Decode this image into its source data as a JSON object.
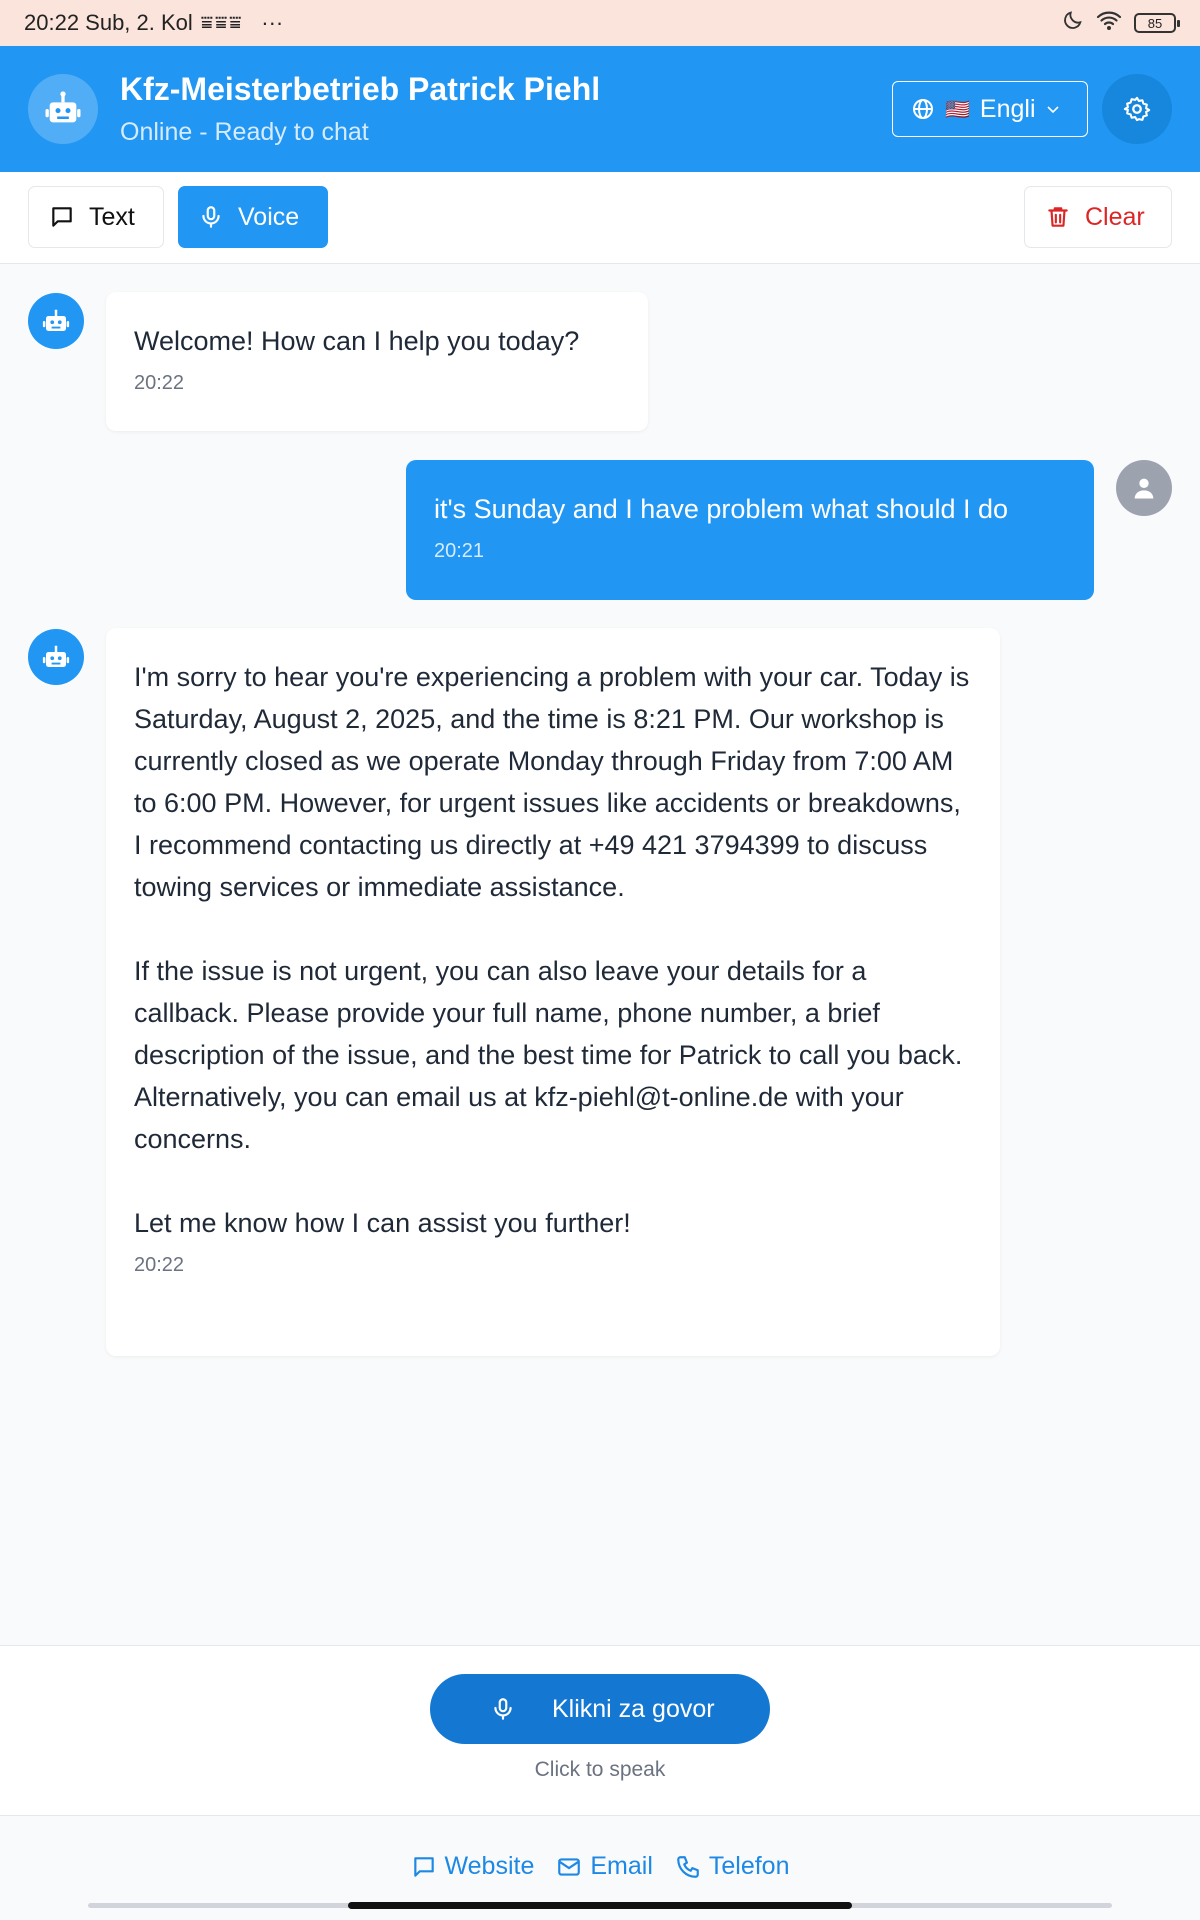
{
  "status_bar": {
    "time_date": "20:22 Sub, 2. Kol",
    "battery": "85"
  },
  "header": {
    "title": "Kfz-Meisterbetrieb Patrick Piehl",
    "subtitle": "Online - Ready to chat",
    "language_label": "Engli",
    "language_flag": "🇺🇸"
  },
  "toolbar": {
    "text_label": "Text",
    "voice_label": "Voice",
    "clear_label": "Clear"
  },
  "messages": [
    {
      "role": "bot",
      "text": "Welcome! How can I help you today?",
      "time": "20:22"
    },
    {
      "role": "user",
      "text": "it's Sunday and I have problem what should I do",
      "time": "20:21"
    },
    {
      "role": "bot",
      "paragraphs": [
        "I'm sorry to hear you're experiencing a problem with your car. Today is Saturday, August 2, 2025, and the time is 8:21 PM. Our workshop is currently closed as we operate Monday through Friday from 7:00 AM to 6:00 PM. However, for urgent issues like accidents or breakdowns, I recommend contacting us directly at +49 421 3794399 to discuss towing services or immediate assistance.",
        "If the issue is not urgent, you can also leave your details for a callback. Please provide your full name, phone number, a brief description of the issue, and the best time for Patrick to call you back. Alternatively, you can email us at kfz-piehl@t-online.de with your concerns.",
        "Let me know how I can assist you further!"
      ],
      "time": "20:22"
    }
  ],
  "voice": {
    "button_label": "Klikni za govor",
    "hint": "Click to speak"
  },
  "footer": {
    "website_label": "Website",
    "email_label": "Email",
    "phone_label": "Telefon"
  },
  "colors": {
    "primary": "#2196f3",
    "danger": "#dc2626",
    "background": "#f9fafb"
  }
}
